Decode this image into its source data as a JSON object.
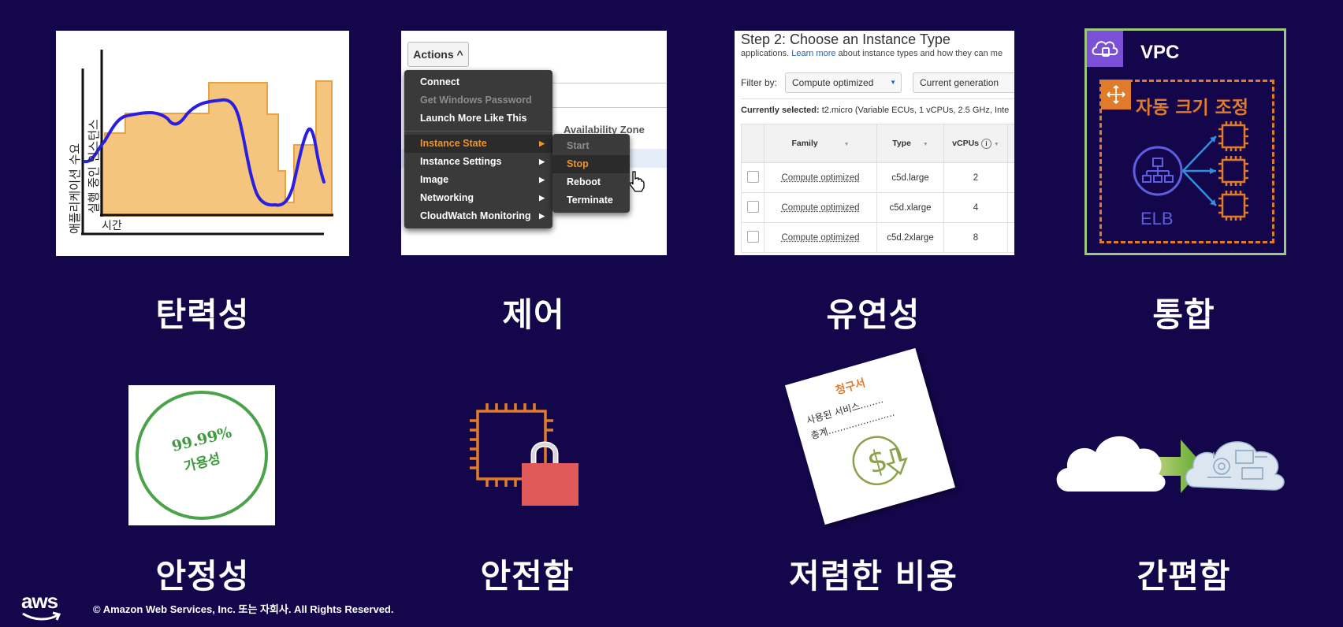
{
  "tiles": {
    "elasticity": {
      "label": "탄력성",
      "ylabel_demand": "애플리케이션 수요",
      "ylabel_instances": "실행 중인 인스턴스",
      "xlabel": "시간",
      "colors": {
        "capacity": "#f5c57e",
        "capacity_edge": "#e8a247",
        "demand": "#2a1fe0"
      }
    },
    "control": {
      "label": "제어",
      "actions_button": "Actions ^",
      "menu": [
        {
          "label": "Connect",
          "state": "normal"
        },
        {
          "label": "Get Windows Password",
          "state": "disabled"
        },
        {
          "label": "Launch More Like This",
          "state": "normal"
        },
        {
          "label": "Instance State",
          "state": "active",
          "submenu": true
        },
        {
          "label": "Instance Settings",
          "state": "normal",
          "submenu": true
        },
        {
          "label": "Image",
          "state": "normal",
          "submenu": true
        },
        {
          "label": "Networking",
          "state": "normal",
          "submenu": true
        },
        {
          "label": "CloudWatch Monitoring",
          "state": "normal",
          "submenu": true
        }
      ],
      "submenu": [
        {
          "label": "Start",
          "state": "disabled"
        },
        {
          "label": "Stop",
          "state": "active"
        },
        {
          "label": "Reboot",
          "state": "normal"
        },
        {
          "label": "Terminate",
          "state": "normal"
        }
      ],
      "bg_header": "Availability Zone"
    },
    "flexibility": {
      "label": "유연성",
      "title": "Step 2: Choose an Instance Type",
      "subtitle_pre": "applications. ",
      "subtitle_link": "Learn more",
      "subtitle_post": " about instance types and how they can me",
      "filter_label": "Filter by:",
      "filter_family": "Compute optimized",
      "filter_generation": "Current generation",
      "selected_label": "Currently selected:",
      "selected_value": " t2.micro (Variable ECUs, 1 vCPUs, 2.5 GHz, Inte",
      "columns": [
        "Family",
        "Type",
        "vCPUs"
      ],
      "rows": [
        {
          "family": "Compute optimized",
          "type": "c5d.large",
          "vcpus": "2"
        },
        {
          "family": "Compute optimized",
          "type": "c5d.xlarge",
          "vcpus": "4"
        },
        {
          "family": "Compute optimized",
          "type": "c5d.2xlarge",
          "vcpus": "8"
        }
      ]
    },
    "integration": {
      "label": "통합",
      "vpc": "VPC",
      "asg": "자동 크기 조정",
      "elb": "ELB",
      "colors": {
        "border": "#9dc77a",
        "dash": "#e07b2a",
        "elb": "#5d5fe0",
        "vpc_icon": "#7b4fd6"
      }
    },
    "reliability": {
      "label": "안정성",
      "percent": "99.99%",
      "availability": "가용성"
    },
    "security": {
      "label": "안전함",
      "colors": {
        "chip": "#e07b2a",
        "lock": "#e05a5a"
      }
    },
    "cost": {
      "label": "저렴한 비용",
      "invoice_title": "청구서",
      "line1": "사용된 서비스........",
      "line2": "총계......................."
    },
    "ease": {
      "label": "간편함"
    }
  },
  "footer": {
    "logo": "aws",
    "copyright": "© Amazon Web Services, Inc. 또는 자회사. All Rights Reserved."
  }
}
